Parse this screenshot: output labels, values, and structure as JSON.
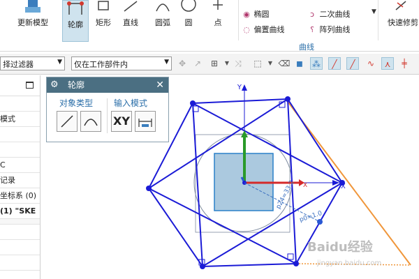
{
  "ribbon": {
    "buttons": [
      {
        "label": "更新模型",
        "icon": "update-model-icon"
      },
      {
        "label": "轮廓",
        "icon": "profile-icon",
        "active": true
      },
      {
        "label": "矩形",
        "icon": "rectangle-icon"
      },
      {
        "label": "直线",
        "icon": "line-icon"
      },
      {
        "label": "圆弧",
        "icon": "arc-icon"
      },
      {
        "label": "圆",
        "icon": "circle-icon"
      },
      {
        "label": "点",
        "icon": "point-icon"
      },
      {
        "label": "快速修剪",
        "icon": "quick-trim-icon"
      }
    ],
    "curve_items": {
      "ellipse": "椭圆",
      "conic": "二次曲线",
      "offset_curve": "偏置曲线",
      "pattern_curve": "阵列曲线"
    },
    "curve_group_label": "曲线"
  },
  "toolbar": {
    "filter_value": "择过滤器",
    "scope_value": "仅在工作部件内"
  },
  "navigator": {
    "rows": [
      "",
      "模式",
      "",
      "",
      "C",
      "记录",
      "坐标系 (0)",
      "(1) \"SKE",
      "",
      "",
      ""
    ],
    "bold_row": 7
  },
  "dialog": {
    "title": "轮廓",
    "object_type_label": "对象类型",
    "input_mode_label": "输入模式",
    "xy_button": "XY"
  },
  "sketch": {
    "axis_y": "Y",
    "axis_x": "X",
    "axis_xm": "X",
    "dim_label": "p24=33.2",
    "dim_label2": "p0=1.0",
    "colors": {
      "sketch": "#1b1bd6",
      "axis_x": "#d42a2a",
      "axis_y": "#2a9a2a",
      "axis_z": "#2a58d4",
      "guide": "#f0963a"
    }
  },
  "watermark": {
    "brand": "Baidu经验",
    "url": "jingyan.baidu.com"
  }
}
